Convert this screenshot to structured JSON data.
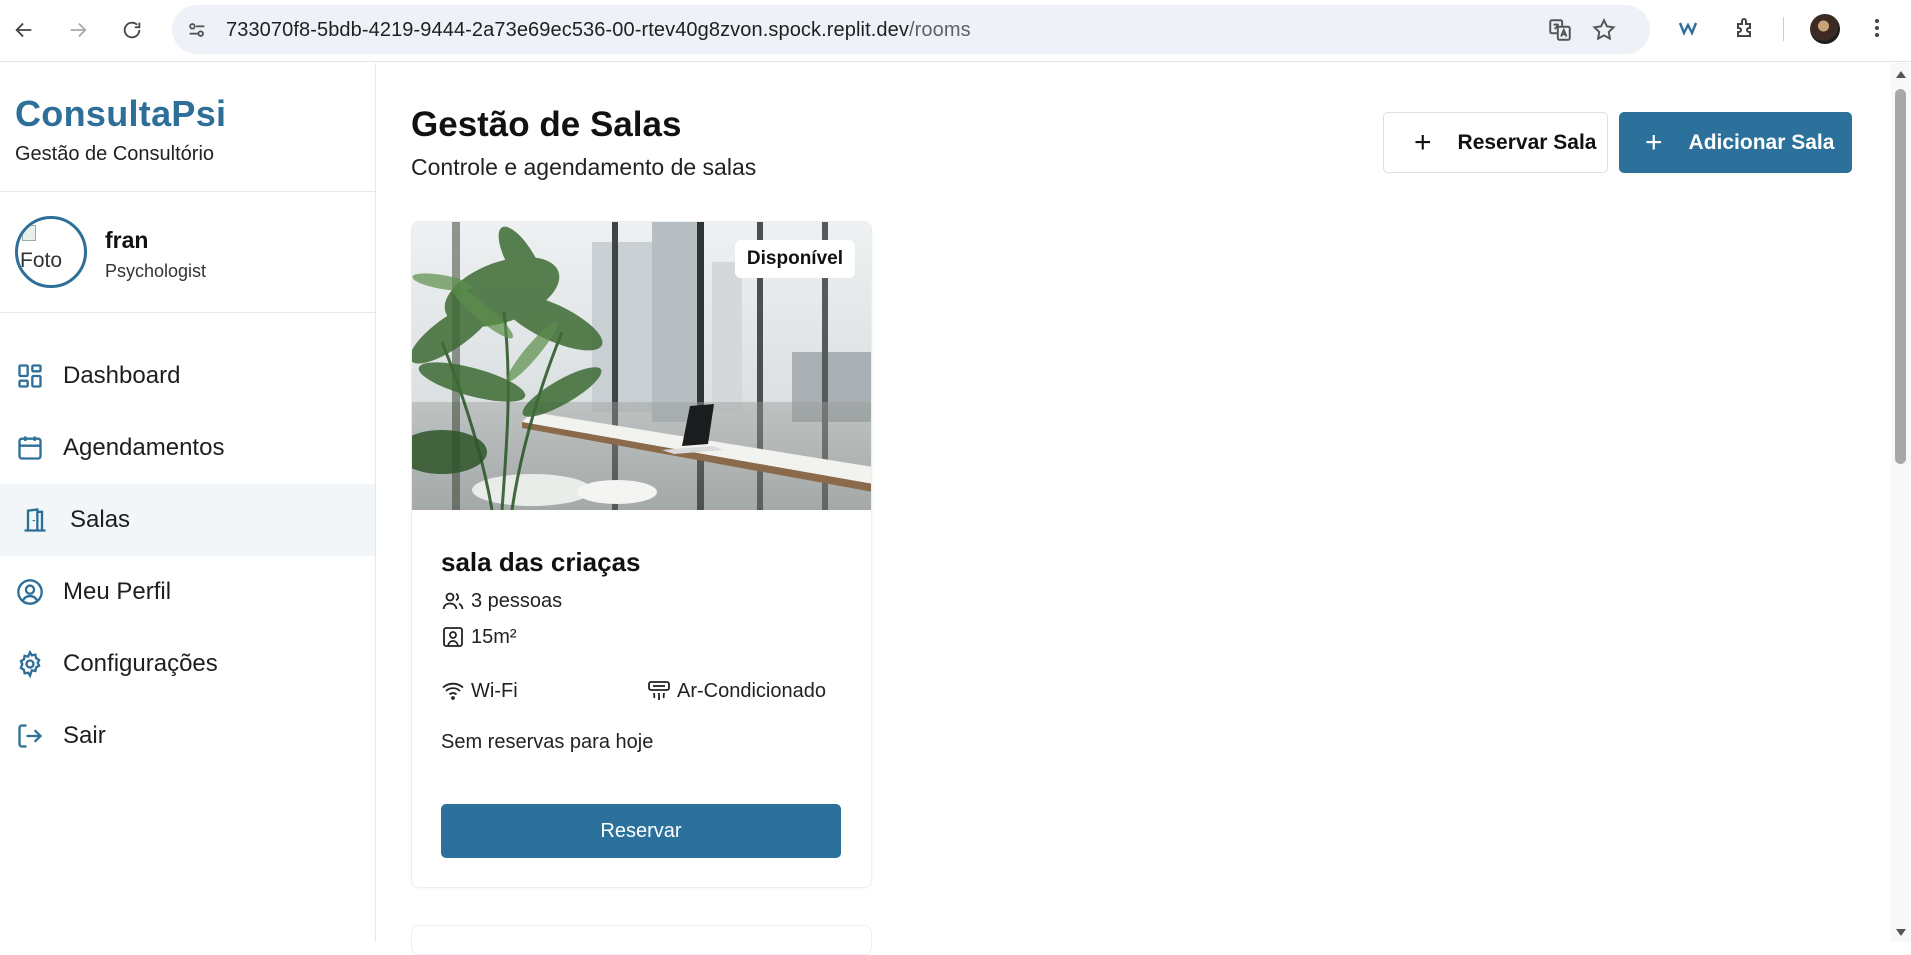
{
  "browser": {
    "url_host": "733070f8-5bdb-4219-9444-2a73e69ec536-00-rtev40g8zvon.spock.replit.dev",
    "url_path": "/rooms",
    "icons": [
      "back-icon",
      "forward-icon",
      "reload-icon",
      "site-info-icon",
      "translate-icon",
      "star-icon",
      "extension-w-icon",
      "extensions-icon",
      "profile-avatar",
      "menu-icon"
    ]
  },
  "sidebar": {
    "brand": "ConsultaPsi",
    "brand_subtitle": "Gestão de Consultório",
    "profile": {
      "photo_alt": "Foto",
      "name": "fran",
      "role": "Psychologist"
    },
    "items": [
      {
        "label": "Dashboard",
        "icon": "dashboard-icon"
      },
      {
        "label": "Agendamentos",
        "icon": "calendar-icon"
      },
      {
        "label": "Salas",
        "icon": "door-icon",
        "active": true
      },
      {
        "label": "Meu Perfil",
        "icon": "user-circle-icon"
      },
      {
        "label": "Configurações",
        "icon": "gear-icon"
      },
      {
        "label": "Sair",
        "icon": "logout-icon"
      }
    ]
  },
  "main": {
    "title": "Gestão de Salas",
    "subtitle": "Controle e agendamento de salas",
    "reserve_button": "Reservar Sala",
    "add_button": "Adicionar Sala"
  },
  "room_card": {
    "status": "Disponível",
    "name": "sala das criaças",
    "capacity": "3 pessoas",
    "size": "15m²",
    "amenities": [
      "Wi-Fi",
      "Ar-Condicionado"
    ],
    "reservations_text": "Sem reservas para hoje",
    "button": "Reservar"
  },
  "colors": {
    "primary": "#2b719b",
    "brand": "#2d6f98",
    "active_bg": "#f2f6f9"
  }
}
